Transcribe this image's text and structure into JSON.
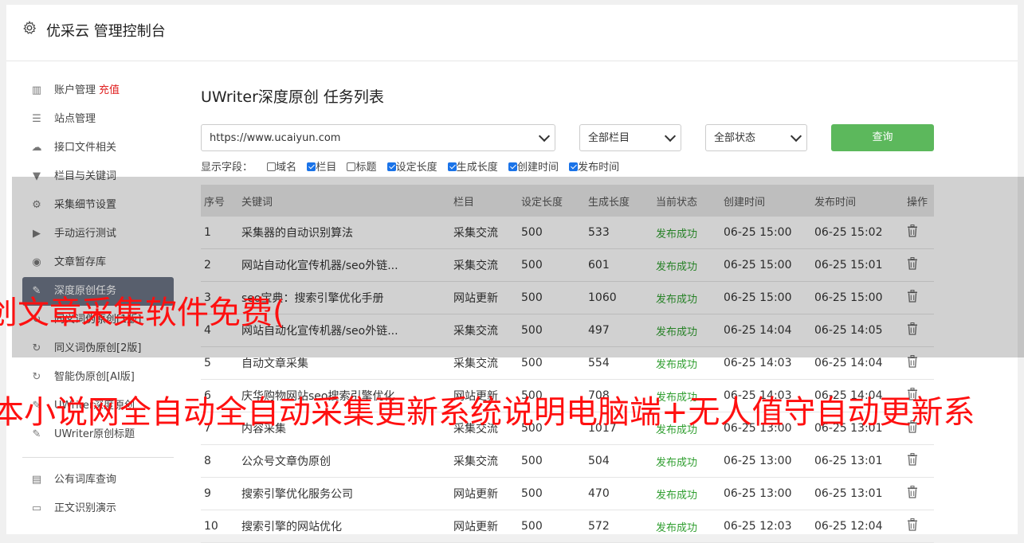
{
  "header": {
    "title": "优采云 管理控制台"
  },
  "sidebar": {
    "items": [
      {
        "icon": "bar-chart-icon",
        "label": "账户管理",
        "extra": "充值"
      },
      {
        "icon": "server-icon",
        "label": "站点管理"
      },
      {
        "icon": "cloud-upload-icon",
        "label": "接口文件相关"
      },
      {
        "icon": "filter-icon",
        "label": "栏目与关键词"
      },
      {
        "icon": "gears-icon",
        "label": "采集细节设置"
      },
      {
        "icon": "play-icon",
        "label": "手动运行测试"
      },
      {
        "icon": "database-icon",
        "label": "文章暂存库"
      },
      {
        "icon": "edit-icon",
        "label": "深度原创任务"
      },
      {
        "icon": "refresh-icon",
        "label": "同义词伪原创[1版]"
      },
      {
        "icon": "refresh-icon",
        "label": "同义词伪原创[2版]"
      },
      {
        "icon": "refresh-icon",
        "label": "智能伪原创[AI版]"
      },
      {
        "icon": "edit-icon",
        "label": "UWriter深度原创"
      },
      {
        "icon": "edit-icon",
        "label": "UWriter原创标题"
      }
    ],
    "items2": [
      {
        "icon": "book-icon",
        "label": "公有词库查询"
      },
      {
        "icon": "monitor-icon",
        "label": "正文识别演示"
      }
    ]
  },
  "main": {
    "title": "UWriter深度原创 任务列表",
    "site_select": "https://www.ucaiyun.com",
    "column_select": "全部栏目",
    "status_select": "全部状态",
    "query_button": "查询",
    "fields_label": "显示字段：",
    "fields": [
      {
        "label": "域名",
        "checked": false
      },
      {
        "label": "栏目",
        "checked": true
      },
      {
        "label": "标题",
        "checked": false
      },
      {
        "label": "设定长度",
        "checked": true
      },
      {
        "label": "生成长度",
        "checked": true
      },
      {
        "label": "创建时间",
        "checked": true
      },
      {
        "label": "发布时间",
        "checked": true
      }
    ],
    "table": {
      "headers": [
        "序号",
        "关键词",
        "栏目",
        "设定长度",
        "生成长度",
        "当前状态",
        "创建时间",
        "发布时间",
        "操作"
      ],
      "rows": [
        [
          "1",
          "采集器的自动识别算法",
          "采集交流",
          "500",
          "533",
          "发布成功",
          "06-25 15:00",
          "06-25 15:02"
        ],
        [
          "2",
          "网站自动化宣传机器/seo外链...",
          "采集交流",
          "500",
          "601",
          "发布成功",
          "06-25 15:00",
          "06-25 15:01"
        ],
        [
          "3",
          "seo宝典：搜索引擎优化手册",
          "网站更新",
          "500",
          "1060",
          "发布成功",
          "06-25 15:00",
          "06-25 15:00"
        ],
        [
          "4",
          "网站自动化宣传机器/seo外链...",
          "采集交流",
          "500",
          "497",
          "发布成功",
          "06-25 14:04",
          "06-25 14:05"
        ],
        [
          "5",
          "自动文章采集",
          "采集交流",
          "500",
          "554",
          "发布成功",
          "06-25 14:03",
          "06-25 14:04"
        ],
        [
          "6",
          "庆华购物网站seo搜索引擎优化",
          "网站更新",
          "500",
          "708",
          "发布成功",
          "06-25 14:03",
          "06-25 14:04"
        ],
        [
          "7",
          "内容采集",
          "采集交流",
          "500",
          "1017",
          "发布成功",
          "06-25 13:00",
          "06-25 13:01"
        ],
        [
          "8",
          "公众号文章伪原创",
          "采集交流",
          "500",
          "504",
          "发布成功",
          "06-25 13:00",
          "06-25 13:01"
        ],
        [
          "9",
          "搜索引擎优化服务公司",
          "网站更新",
          "500",
          "470",
          "发布成功",
          "06-25 13:00",
          "06-25 13:01"
        ],
        [
          "10",
          "搜索引擎的网站优化",
          "网站更新",
          "500",
          "572",
          "发布成功",
          "06-25 12:03",
          "06-25 12:04"
        ]
      ]
    }
  },
  "watermarks": {
    "line1": "创文章采集软件免费(",
    "line2": "本小说网全自动全自动采集更新系统说明电脑端+无人值守自动更新系"
  }
}
